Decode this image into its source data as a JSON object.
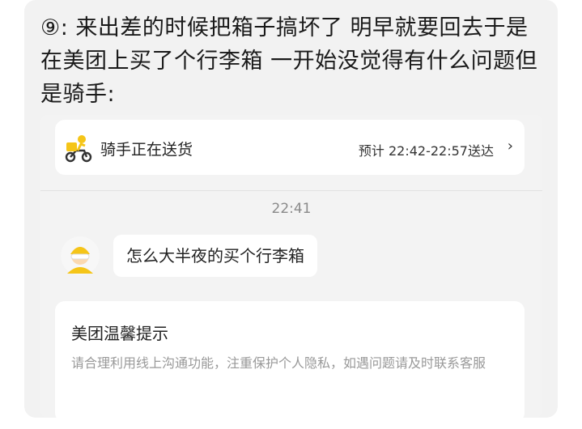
{
  "caption": {
    "number": "⑨",
    "text": ": 来出差的时候把箱子搞坏了 明早就要回去于是在美团上买了个行李箱 一开始没觉得有什么问题但是骑手:"
  },
  "rider_card": {
    "status": "骑手正在送货",
    "eta": "预计 22:42-22:57送达",
    "chevron": "›"
  },
  "chat": {
    "timestamp": "22:41",
    "messages": [
      {
        "text": "怎么大半夜的买个行李箱"
      }
    ]
  },
  "tip": {
    "title": "美团温馨提示",
    "body": "请合理利用线上沟通功能，注重保护个人隐私，如遇问题请及时联系客服"
  },
  "colors": {
    "card_bg": "#f2f2f2",
    "rider_yellow": "#f5c518",
    "muted_text": "#999999"
  }
}
